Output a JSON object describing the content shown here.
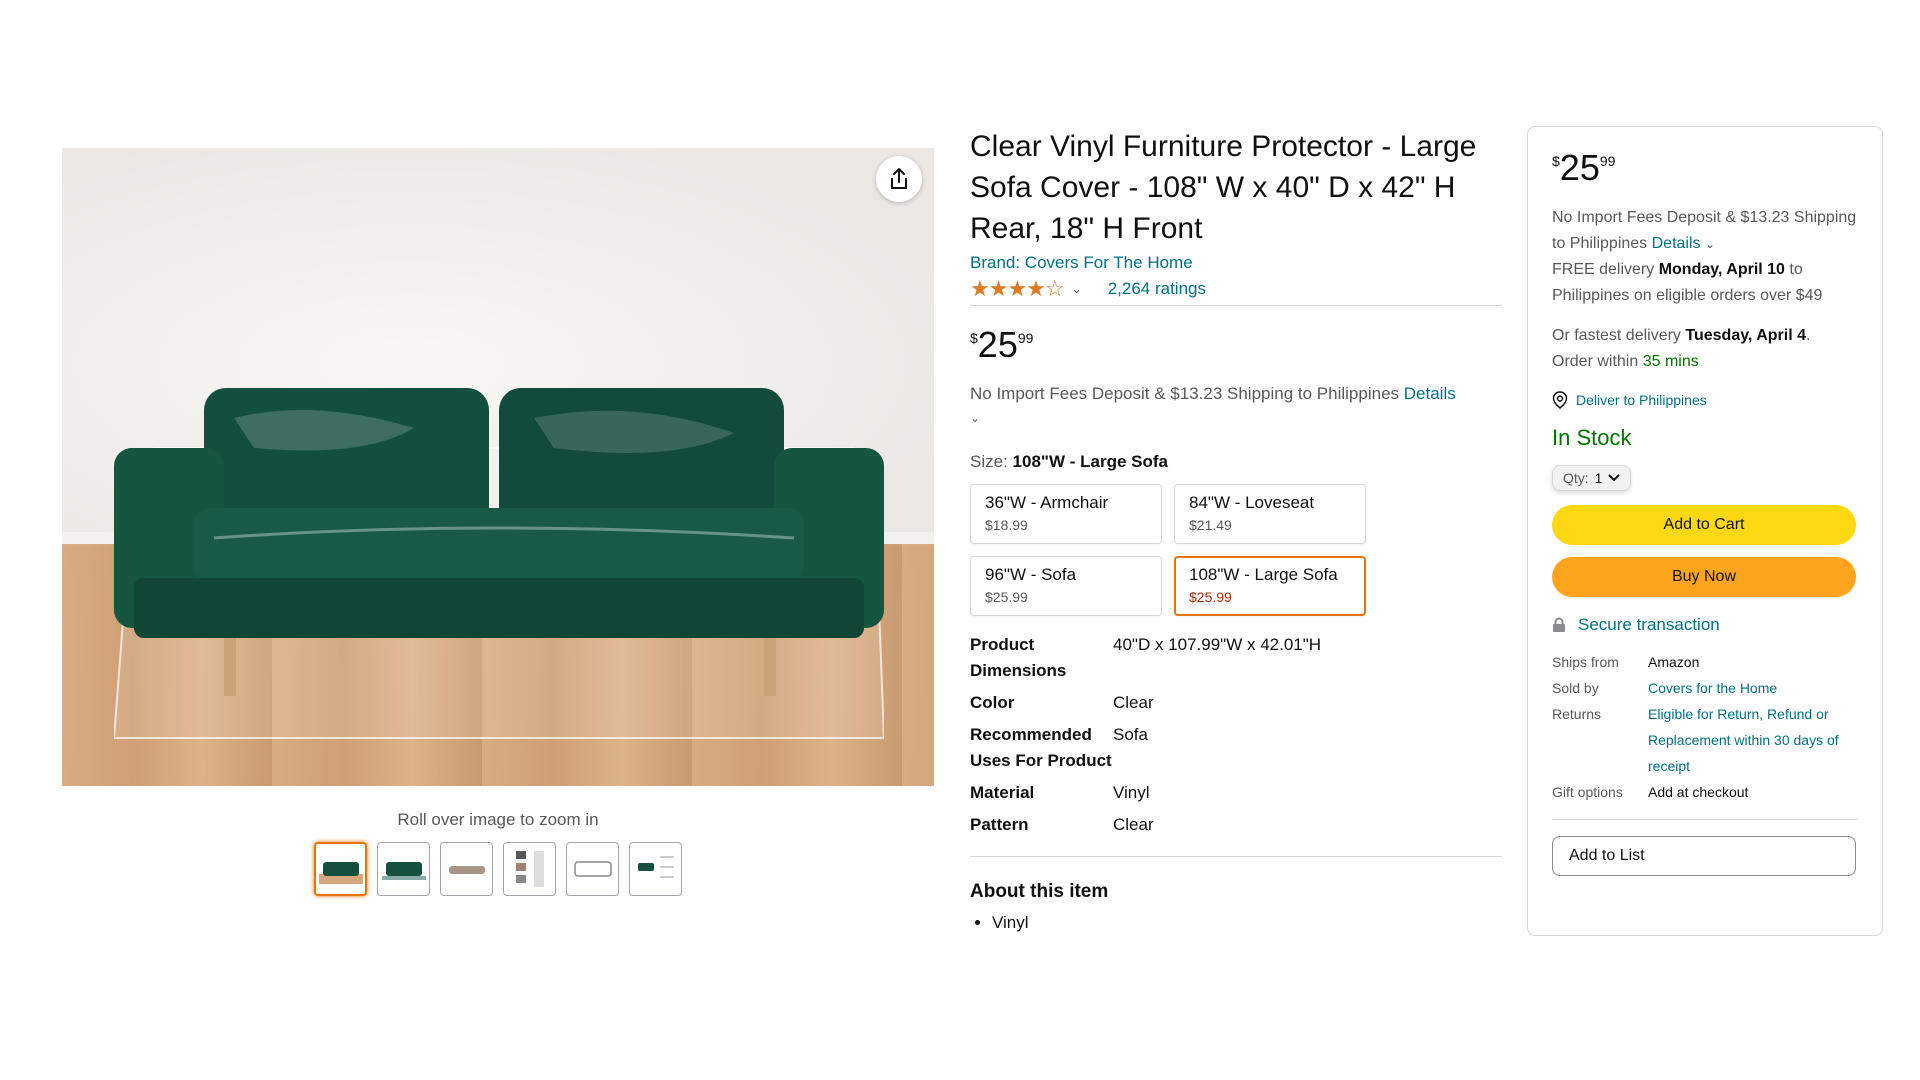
{
  "gallery": {
    "zoom_hint": "Roll over image to zoom in",
    "share_icon": "share-icon",
    "thumbnails": [
      "thumb-1",
      "thumb-2",
      "thumb-3",
      "thumb-4",
      "thumb-5",
      "thumb-6"
    ],
    "selected_thumbnail": 0
  },
  "product": {
    "title": "Clear Vinyl Furniture Protector - Large Sofa Cover - 108\" W x 40\" D x 42\" H Rear, 18\" H Front",
    "brand": "Brand: Covers For The Home",
    "stars": "★★★★☆",
    "rating_value": 4.3,
    "ratings_count": "2,264 ratings",
    "price": {
      "symbol": "$",
      "whole": "25",
      "fraction": "99"
    },
    "shipping_note": "No Import Fees Deposit & $13.23 Shipping to Philippines",
    "shipping_details_link": "Details",
    "size_label": "Size:",
    "size_selected": "108\"W - Large Sofa",
    "sizes": [
      {
        "name": "36\"W - Armchair",
        "price": "$18.99"
      },
      {
        "name": "84\"W - Loveseat",
        "price": "$21.49"
      },
      {
        "name": "96\"W - Sofa",
        "price": "$25.99"
      },
      {
        "name": "108\"W - Large Sofa",
        "price": "$25.99"
      }
    ],
    "specs": [
      {
        "key": "Product Dimensions",
        "value": "40\"D x 107.99\"W x 42.01\"H"
      },
      {
        "key": "Color",
        "value": "Clear"
      },
      {
        "key": "Recommended Uses For Product",
        "value": "Sofa"
      },
      {
        "key": "Material",
        "value": "Vinyl"
      },
      {
        "key": "Pattern",
        "value": "Clear"
      }
    ],
    "about_heading": "About this item",
    "about_items": [
      "Vinyl"
    ]
  },
  "buybox": {
    "price": {
      "symbol": "$",
      "whole": "25",
      "fraction": "99"
    },
    "ship_line1": "No Import Fees Deposit & $13.23 Shipping to Philippines",
    "ship_details_link": "Details",
    "free_delivery_prefix": "FREE delivery",
    "free_delivery_date": "Monday, April 10",
    "free_delivery_suffix": "to Philippines on eligible orders over $49",
    "fast_prefix": "Or fastest delivery",
    "fast_date": "Tuesday, April 4",
    "order_within_prefix": "Order within",
    "order_within_time": "35 mins",
    "deliver_to": "Deliver to Philippines",
    "stock": "In Stock",
    "qty_label": "Qty:",
    "qty_value": "1",
    "add_to_cart": "Add to Cart",
    "buy_now": "Buy Now",
    "secure": "Secure transaction",
    "ships_from_label": "Ships from",
    "ships_from": "Amazon",
    "sold_by_label": "Sold by",
    "sold_by": "Covers for the Home",
    "returns_label": "Returns",
    "returns": "Eligible for Return, Refund or Replacement within 30 days of receipt",
    "gift_label": "Gift options",
    "gift": "Add at checkout",
    "add_to_list": "Add to List"
  },
  "colors": {
    "link": "#007185",
    "accent_orange": "#e77600",
    "cart_yellow": "#ffd814",
    "buy_orange": "#ffa41c",
    "stock_green": "#007600",
    "price_red": "#b12704"
  }
}
